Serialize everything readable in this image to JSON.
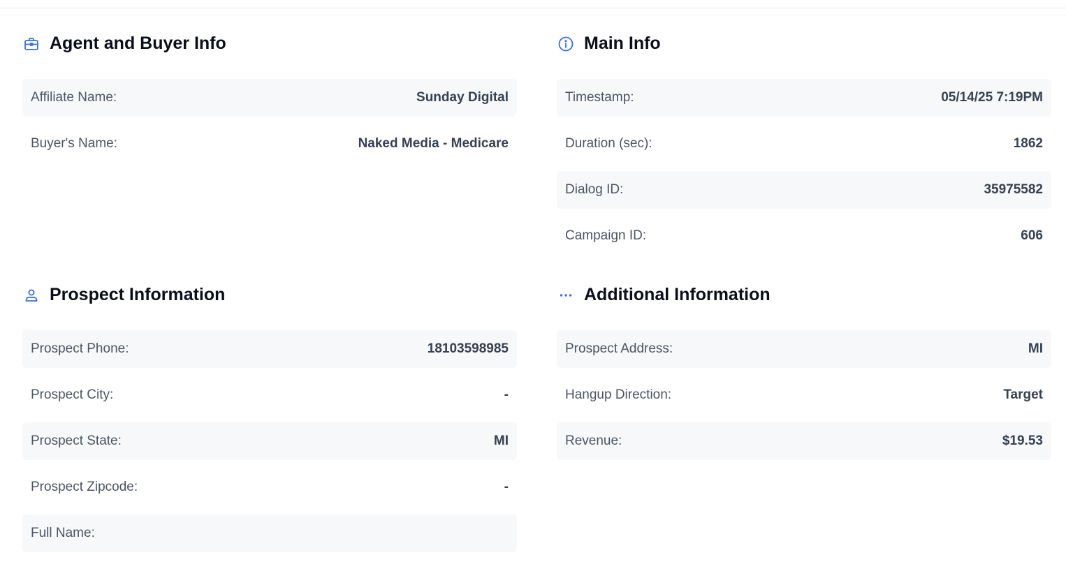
{
  "colors": {
    "accent": "#3b6fe0",
    "row_shade": "#f7f8fa",
    "label": "#4b5563",
    "value": "#374151",
    "title": "#0b0f19"
  },
  "sections": {
    "agent_buyer": {
      "icon": "briefcase-icon",
      "title": "Agent and Buyer Info",
      "rows": [
        {
          "label": "Affiliate Name:",
          "value": "Sunday Digital"
        },
        {
          "label": "Buyer's Name:",
          "value": "Naked Media - Medicare"
        }
      ]
    },
    "main_info": {
      "icon": "info-circle-icon",
      "title": "Main Info",
      "rows": [
        {
          "label": "Timestamp:",
          "value": "05/14/25 7:19PM"
        },
        {
          "label": "Duration (sec):",
          "value": "1862"
        },
        {
          "label": "Dialog ID:",
          "value": "35975582"
        },
        {
          "label": "Campaign ID:",
          "value": "606"
        }
      ]
    },
    "prospect": {
      "icon": "user-icon",
      "title": "Prospect Information",
      "rows": [
        {
          "label": "Prospect Phone:",
          "value": "18103598985"
        },
        {
          "label": "Prospect City:",
          "value": "-"
        },
        {
          "label": "Prospect State:",
          "value": "MI"
        },
        {
          "label": "Prospect Zipcode:",
          "value": "-"
        },
        {
          "label": "Full Name:",
          "value": ""
        }
      ]
    },
    "additional": {
      "icon": "more-dots-icon",
      "title": "Additional Information",
      "rows": [
        {
          "label": "Prospect Address:",
          "value": "MI"
        },
        {
          "label": "Hangup Direction:",
          "value": "Target"
        },
        {
          "label": "Revenue:",
          "value": "$19.53"
        }
      ]
    }
  }
}
